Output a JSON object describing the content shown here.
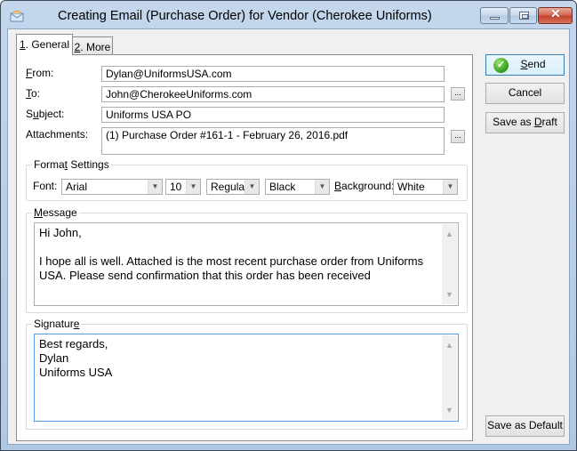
{
  "window": {
    "title": "Creating Email  (Purchase Order)  for Vendor  (Cherokee Uniforms)",
    "controls": {
      "minimize": "minimize",
      "maximize": "maximize",
      "close": "✕"
    }
  },
  "tabs": [
    {
      "key": "1",
      "label": ". General",
      "active": true
    },
    {
      "key": "2",
      "label": ". More",
      "active": false
    }
  ],
  "form": {
    "from": {
      "label_key": "F",
      "label_rest": "rom:",
      "value": "Dylan@UniformsUSA.com"
    },
    "to": {
      "label_key": "T",
      "label_rest": "o:",
      "value": "John@CherokeeUniforms.com"
    },
    "subject": {
      "label_pre": "S",
      "label_key": "u",
      "label_rest": "bject:",
      "value": "Uniforms USA PO"
    },
    "attachments": {
      "label": "Attachments:",
      "value": "(1)  Purchase Order #161-1 - February 26, 2016.pdf"
    },
    "browse_label": "..."
  },
  "format": {
    "title_pre": "Forma",
    "title_key": "t",
    "title_rest": " Settings",
    "font_label": "Font:",
    "font": "Arial",
    "size": "10",
    "style": "Regula",
    "color": "Black",
    "background_key": "B",
    "background_rest": "ackground:",
    "background": "White"
  },
  "message": {
    "title_key": "M",
    "title_rest": "essage",
    "text": "Hi John,\n\nI hope all is well. Attached is the most recent purchase order from Uniforms USA. Please send confirmation that this order has been received"
  },
  "signature": {
    "title_pre": "Signatur",
    "title_key": "e",
    "text": "Best regards,\nDylan\nUniforms USA"
  },
  "buttons": {
    "send_key": "S",
    "send_rest": "end",
    "cancel": "Cancel",
    "draft_pre": "Save as ",
    "draft_key": "D",
    "draft_rest": "raft",
    "save_default": "Save as Default"
  },
  "scroll_glyphs": {
    "up": "▲",
    "down": "▼"
  },
  "combo_arrow": "▼"
}
